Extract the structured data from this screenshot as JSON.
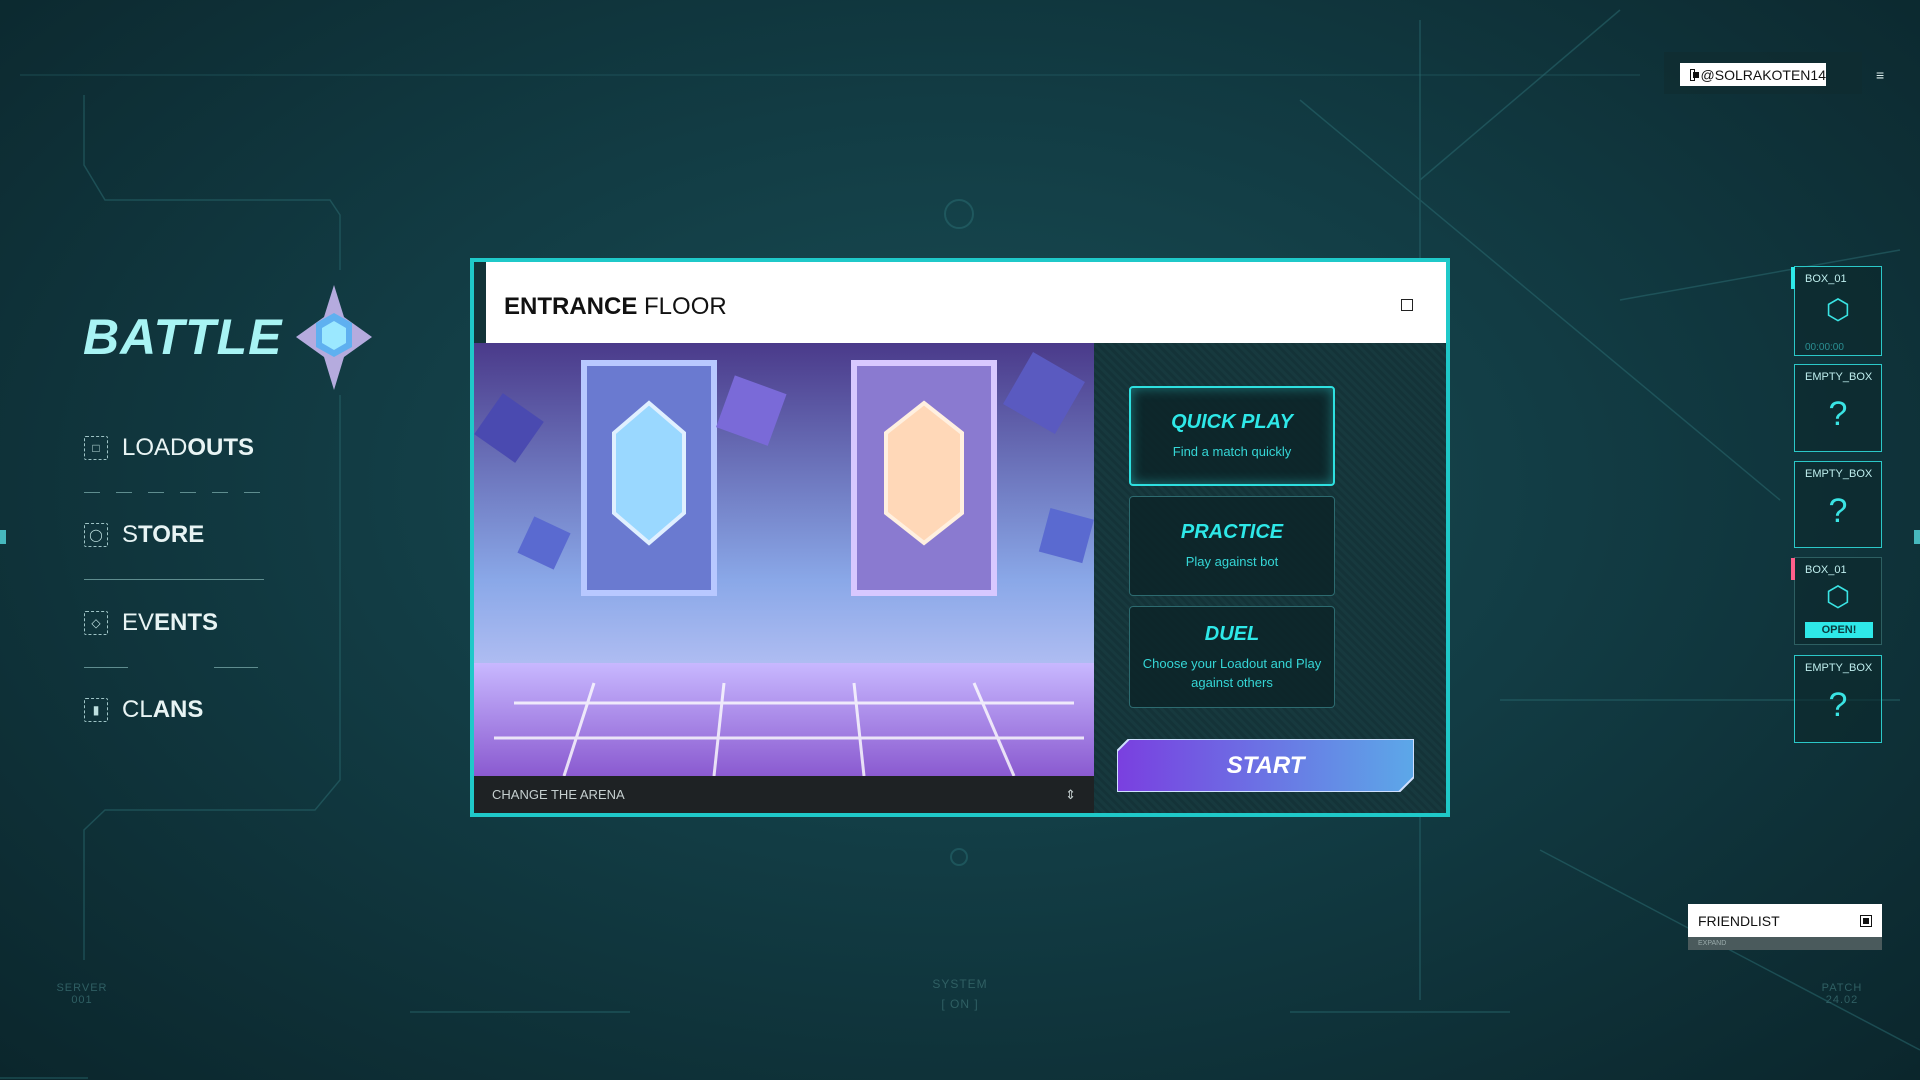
{
  "header": {
    "username": "@SOLRAKOTEN14",
    "menu_icon": "hamburger-icon"
  },
  "nav": {
    "title": "BATTLE",
    "items": [
      {
        "light": "LOAD",
        "bold": "OUTS",
        "icon": "loadouts-icon"
      },
      {
        "light": "S",
        "bold": "TORE",
        "icon": "store-icon"
      },
      {
        "light": "EV",
        "bold": "ENTS",
        "icon": "events-icon"
      },
      {
        "light": "CL",
        "bold": "ANS",
        "icon": "clans-icon"
      }
    ]
  },
  "panel": {
    "title_bold": "ENTRANCE",
    "title_light": "FLOOR",
    "arena_label": "CHANGE THE ARENA",
    "modes": [
      {
        "title": "QUICK PLAY",
        "desc": "Find a match quickly",
        "active": true
      },
      {
        "title": "PRACTICE",
        "desc": "Play against bot",
        "active": false
      },
      {
        "title": "DUEL",
        "desc": "Choose your Loadout and Play against others",
        "active": false
      }
    ],
    "start_label": "START"
  },
  "inventory": [
    {
      "label": "BOX_01",
      "type": "box",
      "timer": "00:00:00",
      "flag": "#2ee8e8"
    },
    {
      "label": "EMPTY_BOX",
      "type": "empty"
    },
    {
      "label": "EMPTY_BOX",
      "type": "empty"
    },
    {
      "label": "BOX_01",
      "type": "open",
      "action": "OPEN!",
      "flag": "#ff5f8a"
    },
    {
      "label": "EMPTY_BOX",
      "type": "empty"
    }
  ],
  "friendlist": {
    "label": "FRIENDLIST",
    "expand": "EXPAND"
  },
  "footer": {
    "left_label": "SERVER",
    "left_value": "001",
    "center_label": "SYSTEM",
    "center_value": "[ ON ]",
    "right_label": "PATCH",
    "right_value": "24.02"
  },
  "colors": {
    "accent": "#2ee8e8",
    "panel_border": "#1fc9c9",
    "start_from": "#7a3fe0",
    "start_to": "#5ca8e8"
  }
}
